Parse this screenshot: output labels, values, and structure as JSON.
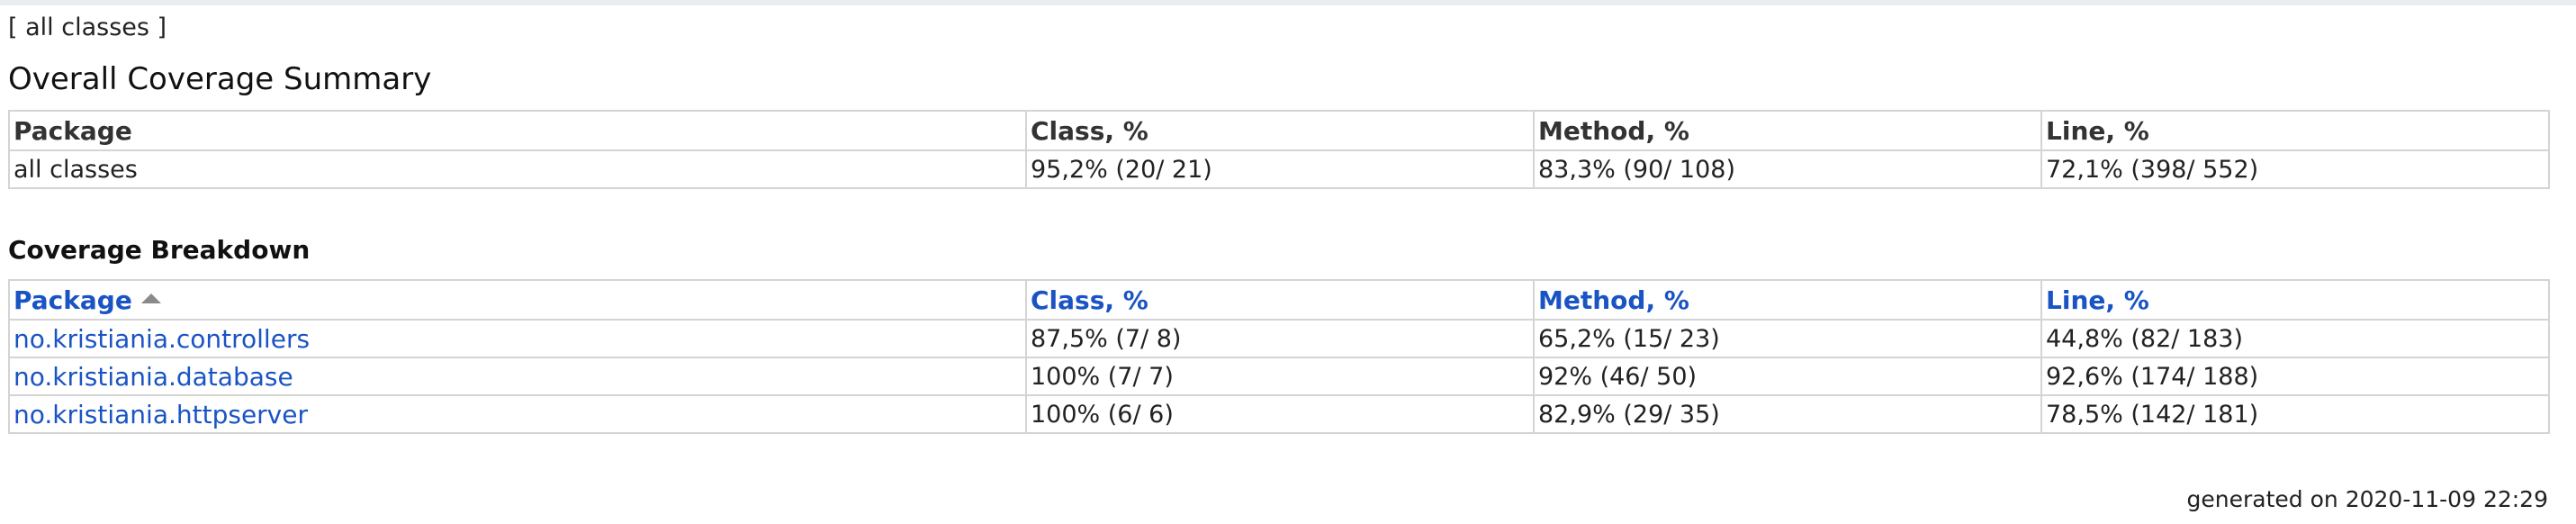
{
  "breadcrumb": {
    "open": "[ ",
    "link_label": "all classes",
    "close": " ]"
  },
  "summary": {
    "title": "Overall Coverage Summary",
    "columns": [
      "Package",
      "Class, %",
      "Method, %",
      "Line, %"
    ],
    "row": {
      "package": "all classes",
      "class": "95,2% (20/ 21)",
      "method": "83,3% (90/ 108)",
      "line": "72,1% (398/ 552)"
    }
  },
  "breakdown": {
    "title": "Coverage Breakdown",
    "columns": [
      "Package",
      "Class, %",
      "Method, %",
      "Line, %"
    ],
    "sort_icon": "sort-ascending-icon",
    "rows": [
      {
        "package": "no.kristiania.controllers",
        "class": "87,5% (7/ 8)",
        "method": "65,2% (15/ 23)",
        "line": "44,8% (82/ 183)"
      },
      {
        "package": "no.kristiania.database",
        "class": "100% (7/ 7)",
        "method": "92% (46/ 50)",
        "line": "92,6% (174/ 188)"
      },
      {
        "package": "no.kristiania.httpserver",
        "class": "100% (6/ 6)",
        "method": "82,9% (29/ 35)",
        "line": "78,5% (142/ 181)"
      }
    ]
  },
  "footer": {
    "generated": "generated on 2020-11-09 22:29"
  },
  "colors": {
    "link": "#1a54c4",
    "border": "#d4d4d4",
    "top_rule": "#e8edf2"
  }
}
